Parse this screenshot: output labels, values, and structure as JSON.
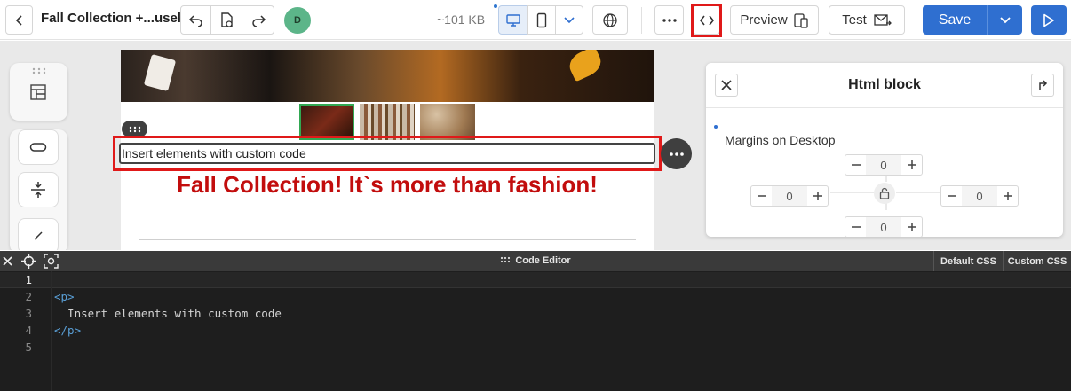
{
  "header": {
    "title": "Fall Collection +...usel",
    "avatar_initial": "D",
    "email_size": "~101 KB",
    "preview_label": "Preview",
    "test_label": "Test",
    "save_label": "Save"
  },
  "canvas": {
    "html_block_text": "Insert elements with custom code",
    "headline": "Fall Collection! It`s more than fashion!"
  },
  "props_panel": {
    "title": "Html block",
    "margins_label": "Margins on Desktop",
    "margins": {
      "top": "0",
      "left": "0",
      "right": "0",
      "bottom": "0"
    }
  },
  "code_editor": {
    "title": "Code Editor",
    "tabs": [
      "Default CSS",
      "Custom CSS"
    ],
    "lines": [
      {
        "num": "1",
        "text": ""
      },
      {
        "num": "2",
        "text": "<p>"
      },
      {
        "num": "3",
        "text": "  Insert elements with custom code"
      },
      {
        "num": "4",
        "text": "</p>"
      },
      {
        "num": "5",
        "text": ""
      }
    ]
  },
  "colors": {
    "accent": "#2f6fd0",
    "highlight": "#e01919",
    "headline": "#c20d0d",
    "editor_bg": "#1e1e1e"
  }
}
